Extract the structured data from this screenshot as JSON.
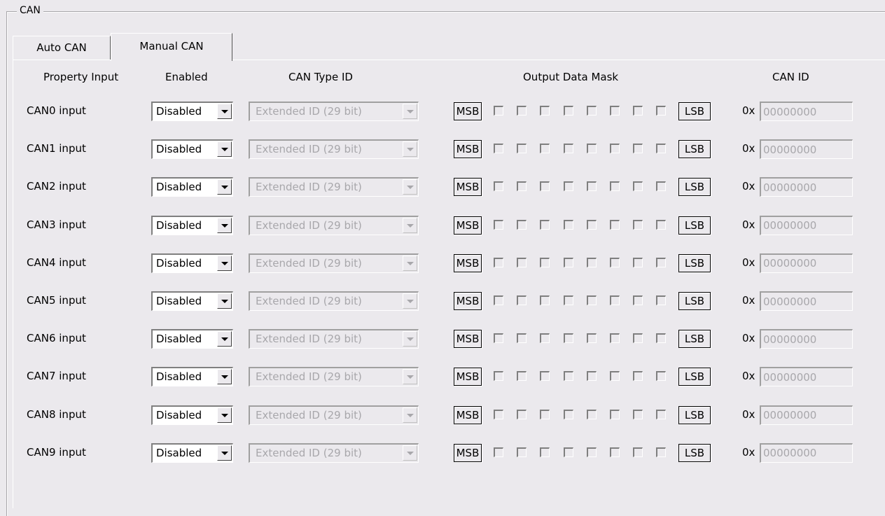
{
  "group_title": "CAN",
  "tabs": [
    {
      "label": "Auto CAN",
      "active": false
    },
    {
      "label": "Manual CAN",
      "active": true
    }
  ],
  "headers": {
    "property_input": "Property Input",
    "enabled": "Enabled",
    "can_type_id": "CAN Type ID",
    "output_data_mask": "Output Data Mask",
    "can_id": "CAN ID"
  },
  "mask": {
    "msb_label": "MSB",
    "lsb_label": "LSB",
    "bit_count": 8
  },
  "hex_prefix": "0x",
  "rows": [
    {
      "label": "CAN0 input",
      "enabled": "Disabled",
      "type_id": "Extended ID (29 bit)",
      "can_id": "00000000"
    },
    {
      "label": "CAN1 input",
      "enabled": "Disabled",
      "type_id": "Extended ID (29 bit)",
      "can_id": "00000000"
    },
    {
      "label": "CAN2 input",
      "enabled": "Disabled",
      "type_id": "Extended ID (29 bit)",
      "can_id": "00000000"
    },
    {
      "label": "CAN3 input",
      "enabled": "Disabled",
      "type_id": "Extended ID (29 bit)",
      "can_id": "00000000"
    },
    {
      "label": "CAN4 input",
      "enabled": "Disabled",
      "type_id": "Extended ID (29 bit)",
      "can_id": "00000000"
    },
    {
      "label": "CAN5 input",
      "enabled": "Disabled",
      "type_id": "Extended ID (29 bit)",
      "can_id": "00000000"
    },
    {
      "label": "CAN6 input",
      "enabled": "Disabled",
      "type_id": "Extended ID (29 bit)",
      "can_id": "00000000"
    },
    {
      "label": "CAN7 input",
      "enabled": "Disabled",
      "type_id": "Extended ID (29 bit)",
      "can_id": "00000000"
    },
    {
      "label": "CAN8 input",
      "enabled": "Disabled",
      "type_id": "Extended ID (29 bit)",
      "can_id": "00000000"
    },
    {
      "label": "CAN9 input",
      "enabled": "Disabled",
      "type_id": "Extended ID (29 bit)",
      "can_id": "00000000"
    }
  ]
}
